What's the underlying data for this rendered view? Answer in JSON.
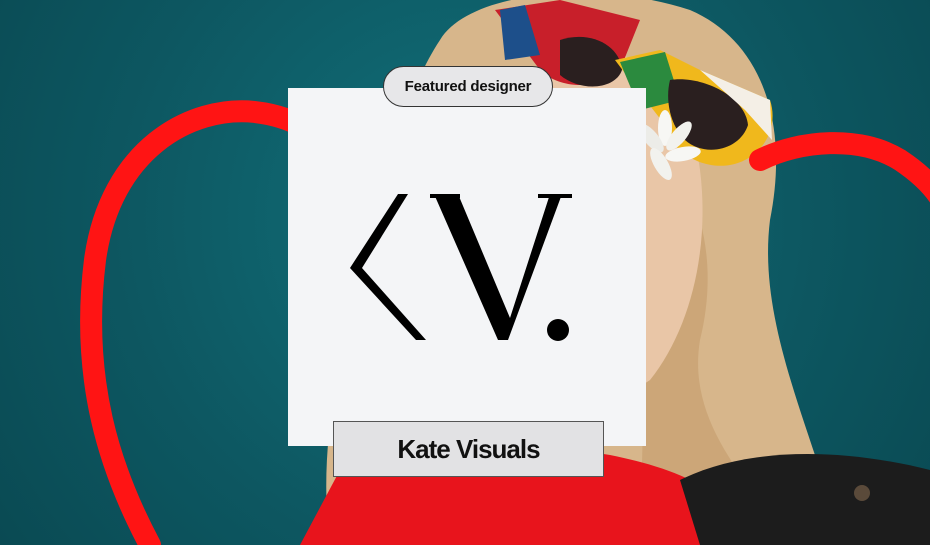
{
  "badge": {
    "label": "Featured designer"
  },
  "designer": {
    "name": "Kate Visuals"
  },
  "icons": {
    "logo": "kv-monogram-logo",
    "decoration": "heart-outline-icon"
  },
  "colors": {
    "background": "#0f5c66",
    "heart": "#ff1414",
    "card": "#f4f5f7",
    "shirt": "#e8141c",
    "hair": "#d9b98f"
  }
}
